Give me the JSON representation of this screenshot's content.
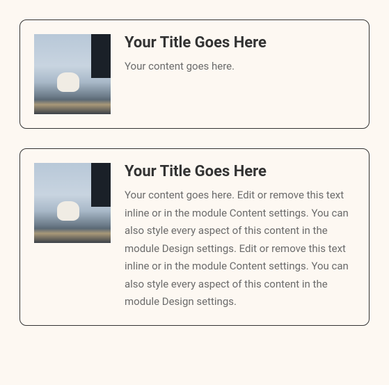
{
  "cards": [
    {
      "title": "Your Title Goes Here",
      "content": "Your content goes here."
    },
    {
      "title": "Your Title Goes Here",
      "content": "Your content goes here. Edit or remove this text inline or in the module Content settings. You can also style every aspect of this content in the module Design settings. Edit or remove this text inline or in the module Content settings. You can also style every aspect of this content in the module Design settings."
    }
  ]
}
